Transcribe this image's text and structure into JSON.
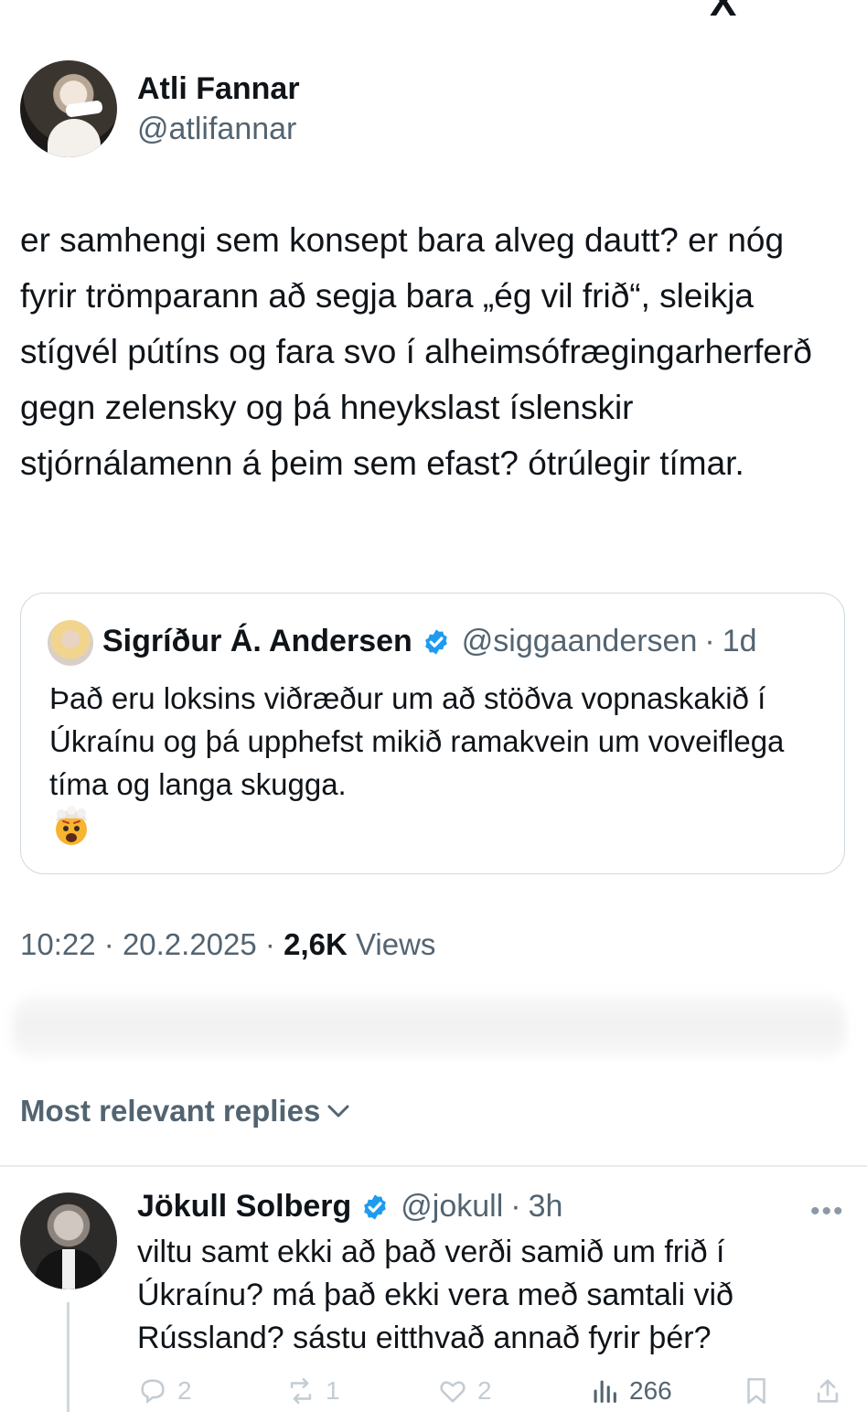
{
  "top_fragment": "X",
  "tweet": {
    "author_name": "Atli Fannar",
    "author_handle": "@atlifannar",
    "text": "er samhengi sem konsept bara alveg dautt? er nóg fyrir trömparann að segja bara „ég vil frið“, sleikja stígvél pútíns og fara svo í alheimsófrægingarherferð gegn zelensky og þá hneykslast íslenskir stjórnálamenn á þeim sem efast? ótrúlegir tímar.",
    "time": "10:22",
    "date": "20.2.2025",
    "separator": "·",
    "views_count": "2,6K",
    "views_label": "Views"
  },
  "quoted": {
    "name": "Sigríður Á. Andersen",
    "handle": "@siggaandersen",
    "separator": "·",
    "time": "1d",
    "text": "Það eru loksins viðræður um að stöðva vopnaskakið í Úkraínu og þá upphefst mikið ramakvein um voveiflega tíma og langa skugga.",
    "emoji": "exploding-head-emoji"
  },
  "replies": {
    "sort_label": "Most relevant replies"
  },
  "reply": {
    "name": "Jökull Solberg",
    "handle": "@jokull",
    "separator": "·",
    "time": "3h",
    "text": "viltu samt ekki að það verði samið um frið í Úkraínu? má það ekki vera með samtali við Rússland? sástu eitthvað annað fyrir þér?",
    "more": "•••",
    "actions": {
      "reply_count": "2",
      "retweet_count": "1",
      "like_count": "2",
      "views_count": "266"
    }
  },
  "colors": {
    "text_primary": "#0f1419",
    "text_secondary": "#536471",
    "verified_blue": "#1d9bf0",
    "border": "#cfd9de"
  }
}
